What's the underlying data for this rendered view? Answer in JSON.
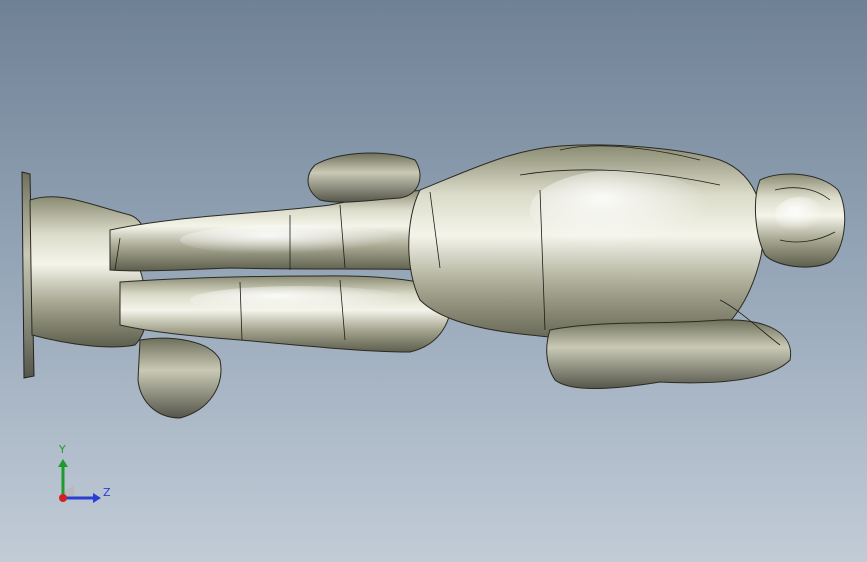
{
  "viewport": {
    "model_icon": "3d-figure-model",
    "background_top": "#6f8195",
    "background_bottom": "#c2ccd7"
  },
  "triad": {
    "y_label": "Y",
    "z_label": "Z",
    "y_color": "#1f9a2c",
    "z_color": "#2a3fcf",
    "x_color": "#d21f1f"
  }
}
